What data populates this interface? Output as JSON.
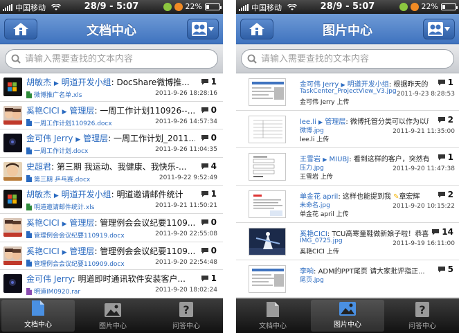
{
  "status": {
    "carrier": "中国移动",
    "time": "28/9 - 5:07",
    "battery": "22%",
    "battery_level": 0.22
  },
  "left": {
    "title": "文档中心",
    "search_placeholder": "请输入需要查找的文本内容",
    "items": [
      {
        "author": "胡敏杰",
        "group": "明道开发小组",
        "text": "DocShare微博推...",
        "file": "微博推广名单.xls",
        "date": "2011-9-26 18:28:16",
        "count": "1",
        "file_type": "xls",
        "avatar": "logo"
      },
      {
        "author": "奚艳CICI",
        "group": "管理层",
        "text": "一周工作计划110926--...",
        "file": "一周工作计划110926.docx",
        "date": "2011-9-26 14:57:34",
        "count": "0",
        "file_type": "doc",
        "avatar": "kids"
      },
      {
        "author": "金可伟 Jerry",
        "group": "管理层",
        "text": "一周工作计划_2011...",
        "file": "一周工作计划.docx",
        "date": "2011-9-26 11:04:35",
        "count": "0",
        "file_type": "doc",
        "avatar": "dark"
      },
      {
        "author": "史超君",
        "group": "",
        "text": "第三期 我运动、我健康、我快乐-...",
        "file": "第三期 乒乓赛.docx",
        "date": "2011-9-22 9:52:49",
        "count": "4",
        "file_type": "doc",
        "avatar": "face"
      },
      {
        "author": "胡敏杰",
        "group": "明道开发小组",
        "text": "明道邀请邮件统计",
        "file": "明道邀请邮件统计.xls",
        "date": "2011-9-21 11:50:21",
        "count": "1",
        "file_type": "xls",
        "avatar": "logo"
      },
      {
        "author": "奚艳CICI",
        "group": "管理层",
        "text": "管理例会会议纪要1109...",
        "file": "管理例会会议纪要110919.docx",
        "date": "2011-9-20 22:55:08",
        "count": "0",
        "file_type": "doc",
        "avatar": "kids"
      },
      {
        "author": "奚艳CICI",
        "group": "管理层",
        "text": "管理例会会议纪要1109...",
        "file": "管理例会会议纪要110909.docx",
        "date": "2011-9-20 22:54:48",
        "count": "0",
        "file_type": "doc",
        "avatar": "kids"
      },
      {
        "author": "金可伟 Jerry",
        "group": "",
        "text": "明道即时通讯软件安装客户...",
        "file": "明道IM0920.rar",
        "date": "2011-9-20 18:02:24",
        "count": "1",
        "file_type": "rar",
        "avatar": "dark"
      }
    ],
    "tabs": [
      {
        "label": "文档中心",
        "active": true
      },
      {
        "label": "图片中心",
        "active": false
      },
      {
        "label": "问答中心",
        "active": false
      }
    ]
  },
  "right": {
    "title": "图片中心",
    "search_placeholder": "请输入需要查找的文本内容",
    "items": [
      {
        "author": "金可伟 Jerry",
        "group": "明道开发小组",
        "text": "根据昨天的...",
        "file": "TaskCenter_ProjectView_V3.jpg",
        "uploader": "金可伟 Jerry 上传",
        "date": "2011-9-23 8:28:53",
        "count": "1",
        "thumb": "doc"
      },
      {
        "author": "lee.li",
        "group": "管理层",
        "text": "微博托管分类可以作为以后...",
        "file": "微博.jpg",
        "uploader": "lee.li 上传",
        "date": "2011-9-21 11:35:00",
        "count": "2",
        "thumb": "table"
      },
      {
        "author": "王雪岩",
        "group": "MIUBJ",
        "text": "看到这样的客户，突然有...",
        "file": "压力.jpg",
        "uploader": "王雪岩 上传",
        "date": "2011-9-20 11:47:38",
        "count": "1",
        "thumb": "form"
      },
      {
        "author": "单金花 april",
        "group": "",
        "text": "这样也能提到我",
        "mention": "章宏辉",
        "file": "未命名.jpg",
        "uploader": "单金花 april 上传",
        "date": "2011-9-20 10:15:22",
        "count": "2",
        "thumb": "page"
      },
      {
        "author": "奚艳CICI",
        "group": "",
        "text": "TCU高寒童鞋做新娘子啦！恭喜...",
        "file": "IMG_0725.jpg",
        "uploader": "奚艳CICI 上传",
        "date": "2011-9-19 16:11:00",
        "count": "14",
        "thumb": "photo"
      },
      {
        "author": "李响",
        "group": "",
        "text": "ADM的PPT尾页 请大家批评指正...",
        "file": "尾页.jpg",
        "uploader": "",
        "date": "",
        "count": "5",
        "thumb": "doc"
      }
    ],
    "tabs": [
      {
        "label": "文档中心",
        "active": false
      },
      {
        "label": "图片中心",
        "active": true
      },
      {
        "label": "问答中心",
        "active": false
      }
    ]
  },
  "colors": {
    "nav_top": "#6f9bd6",
    "nav_bottom": "#3f73bf",
    "link": "#2a6ac0",
    "tabbar": "#111111"
  },
  "icons": {
    "home": "home-icon",
    "users": "users-icon",
    "search": "search-icon",
    "comment": "comment-bubble-icon",
    "doc_tab": "document-icon",
    "image_tab": "image-icon",
    "qa_tab": "question-icon"
  }
}
